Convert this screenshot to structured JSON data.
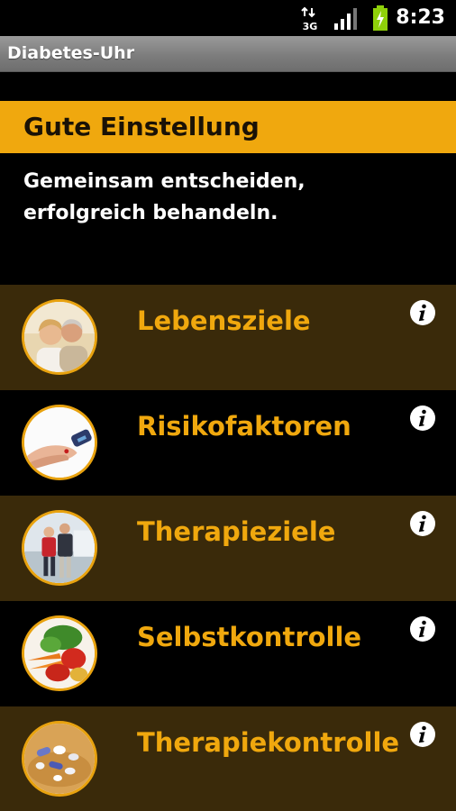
{
  "status_bar": {
    "network": "3G",
    "time": "8:23"
  },
  "app": {
    "title": "Diabetes-Uhr"
  },
  "header": {
    "title": "Gute Einstellung",
    "subtitle_line1": "Gemeinsam entscheiden,",
    "subtitle_line2": "erfolgreich behandeln."
  },
  "colors": {
    "accent": "#f0a80e",
    "row_brown": "#3a2a0a",
    "row_black": "#000000"
  },
  "menu": {
    "items": [
      {
        "label": "Lebensziele",
        "thumbnail": "senior-couple-photo",
        "icon": "info-icon"
      },
      {
        "label": "Risikofaktoren",
        "thumbnail": "blood-glucose-test-photo",
        "icon": "info-icon"
      },
      {
        "label": "Therapieziele",
        "thumbnail": "walking-seniors-photo",
        "icon": "info-icon"
      },
      {
        "label": "Selbstkontrolle",
        "thumbnail": "vegetables-photo",
        "icon": "info-icon"
      },
      {
        "label": "Therapiekontrolle",
        "thumbnail": "pills-photo",
        "icon": "info-icon"
      }
    ]
  }
}
